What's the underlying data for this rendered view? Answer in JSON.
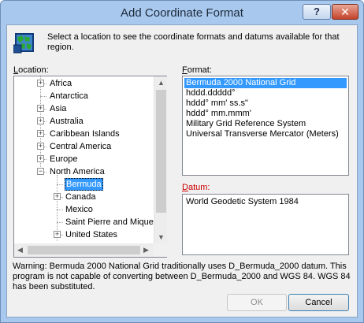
{
  "window": {
    "title": "Add Coordinate Format",
    "help_label": "?",
    "close_label": "✕"
  },
  "intro_text": "Select a location to see the coordinate formats and datums available for that region.",
  "location": {
    "label_key": "L",
    "label_rest": "ocation:",
    "items": [
      {
        "label": "Africa",
        "expander": "+",
        "selected": false
      },
      {
        "label": "Antarctica",
        "expander": "",
        "selected": false
      },
      {
        "label": "Asia",
        "expander": "+",
        "selected": false
      },
      {
        "label": "Australia",
        "expander": "+",
        "selected": false
      },
      {
        "label": "Caribbean Islands",
        "expander": "+",
        "selected": false
      },
      {
        "label": "Central America",
        "expander": "+",
        "selected": false
      },
      {
        "label": "Europe",
        "expander": "+",
        "selected": false
      },
      {
        "label": "North America",
        "expander": "−",
        "selected": false
      },
      {
        "label": "Bermuda",
        "expander": "",
        "selected": true
      },
      {
        "label": "Canada",
        "expander": "+",
        "selected": false
      },
      {
        "label": "Mexico",
        "expander": "",
        "selected": false
      },
      {
        "label": "Saint Pierre and Miquelon",
        "expander": "",
        "selected": false
      },
      {
        "label": "United States",
        "expander": "+",
        "selected": false
      }
    ]
  },
  "format": {
    "label_key": "F",
    "label_rest": "ormat:",
    "items": [
      "Bermuda 2000 National Grid",
      "hddd.ddddd°",
      "hddd° mm' ss.s\"",
      "hddd° mm.mmm'",
      "Military Grid Reference System",
      "Universal Transverse Mercator (Meters)"
    ],
    "selected": "Bermuda 2000 National Grid"
  },
  "datum": {
    "label_key": "D",
    "label_rest": "atum:",
    "value": "World Geodetic System 1984"
  },
  "warning": "Warning: Bermuda 2000 National Grid traditionally uses D_Bermuda_2000 datum.  This program is not capable of converting between D_Bermuda_2000 and WGS 84.  WGS 84 has been substituted.",
  "buttons": {
    "ok": "OK",
    "cancel": "Cancel",
    "ok_enabled": false
  },
  "colors": {
    "selection": "#3399ff",
    "datum_label": "#cc0000",
    "titlebar": "#a9c8ee",
    "close": "#c5432a"
  },
  "icons": [
    "globe-icon",
    "help-icon",
    "close-icon",
    "expand-icon",
    "collapse-icon",
    "scroll-up-icon",
    "scroll-down-icon",
    "scroll-left-icon",
    "scroll-right-icon"
  ]
}
